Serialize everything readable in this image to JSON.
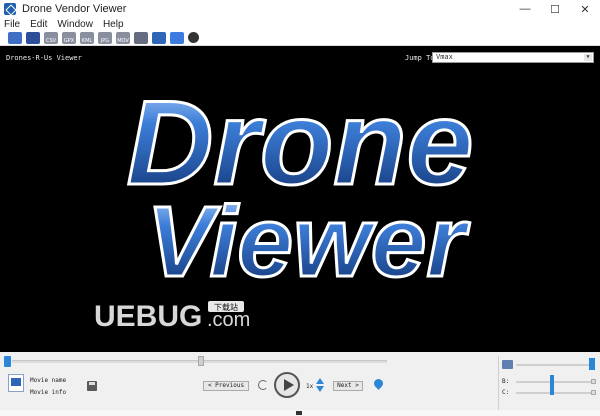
{
  "window": {
    "title": "Drone Vendor Viewer",
    "controls": {
      "minimize": "—",
      "maximize": "☐",
      "close": "✕"
    }
  },
  "menu": [
    "File",
    "Edit",
    "Window",
    "Help"
  ],
  "toolbar": {
    "buttons": [
      {
        "icon": "open-folder-icon",
        "label": ""
      },
      {
        "icon": "stack-icon",
        "label": ""
      },
      {
        "icon": "csv-file-icon",
        "label": "CSV"
      },
      {
        "icon": "gpx-file-icon",
        "label": "GPX"
      },
      {
        "icon": "kml-file-icon",
        "label": "KML"
      },
      {
        "icon": "jpg-file-icon",
        "label": "JPG"
      },
      {
        "icon": "mov-file-icon",
        "label": "MOV"
      },
      {
        "icon": "clip-icon",
        "label": ""
      },
      {
        "icon": "camera-icon",
        "label": ""
      },
      {
        "icon": "grid-icon",
        "label": ""
      },
      {
        "icon": "settings-icon",
        "label": ""
      }
    ]
  },
  "viewer": {
    "name": "Drones-R-Us Viewer",
    "jump_label": "Jump To:",
    "jump_value": "Vmax",
    "logo_line1": "Drone",
    "logo_line2": "Viewer",
    "watermark": "UEBUG",
    "watermark_suffix": ".com",
    "watermark_badge": "下载站"
  },
  "controls": {
    "movie_name_label": "Movie name",
    "movie_info_label": "Movie info",
    "previous_label": "< Previous",
    "next_label": "Next >",
    "speed": "1x",
    "b_label": "B:",
    "c_label": "C:"
  },
  "colors": {
    "accent": "#2b86d8",
    "logo_blue": "#2f66b8"
  }
}
